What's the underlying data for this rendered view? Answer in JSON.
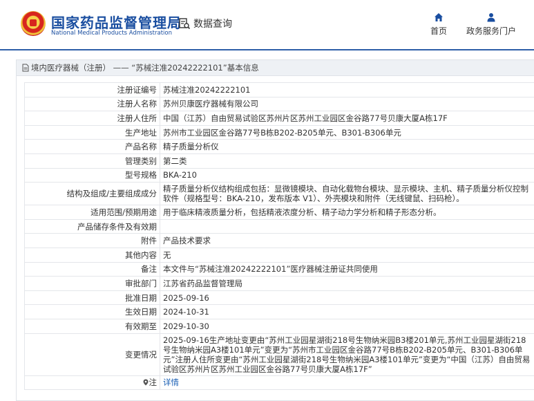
{
  "header": {
    "agency_cn": "国家药品监督管理局",
    "agency_en": "National Medical Products Administration",
    "query_label": "数据查询",
    "nav_home": "首页",
    "nav_portal": "政务服务门户"
  },
  "breadcrumb": "境内医疗器械（注册） —— “苏械注准20242222101”基本信息",
  "rows": [
    {
      "key": "注册证编号",
      "value": "苏械注准20242222101"
    },
    {
      "key": "注册人名称",
      "value": "苏州贝康医疗器械有限公司"
    },
    {
      "key": "注册人住所",
      "value": "中国（江苏）自由贸易试验区苏州片区苏州工业园区金谷路77号贝康大厦A栋17F"
    },
    {
      "key": "生产地址",
      "value": "苏州市工业园区金谷路77号B栋B202-B205单元、B301-B306单元"
    },
    {
      "key": "产品名称",
      "value": "精子质量分析仪"
    },
    {
      "key": "管理类别",
      "value": "第二类"
    },
    {
      "key": "型号规格",
      "value": "BKA-210"
    },
    {
      "key": "结构及组成/主要组成成分",
      "value": "精子质量分析仪结构组成包括：显微镜模块、自动化载物台模块、显示模块、主机、精子质量分析仪控制软件（规格型号：BKA-210，发布版本 V1）、外壳模块和附件（无线键鼠、扫码枪）。"
    },
    {
      "key": "适用范围/预期用途",
      "value": "用于临床精液质量分析，包括精液浓度分析、精子动力学分析和精子形态分析。"
    },
    {
      "key": "产品储存条件及有效期",
      "value": ""
    },
    {
      "key": "附件",
      "value": "产品技术要求"
    },
    {
      "key": "其他内容",
      "value": "无"
    },
    {
      "key": "备注",
      "value": "本文件与“苏械注准20242222101”医疗器械注册证共同使用"
    },
    {
      "key": "审批部门",
      "value": "江苏省药品监督管理局"
    },
    {
      "key": "批准日期",
      "value": "2025-09-16"
    },
    {
      "key": "生效日期",
      "value": "2024-10-31"
    },
    {
      "key": "有效期至",
      "value": "2029-10-30"
    },
    {
      "key": "变更情况",
      "value": "2025-09-16生产地址变更由“苏州工业园星湖街218号生物纳米园B3楼201单元,苏州工业园星湖街218号生物纳米园A3楼101单元”变更为“苏州市工业园区金谷路77号B栋B202-B205单元、B301-B306单元”注册人住所变更由“苏州工业园星湖街218号生物纳米园A3楼101单元”变更为“中国（江苏）自由贸易试验区苏州片区苏州工业园区金谷路77号贝康大厦A栋17F”"
    }
  ],
  "details": {
    "key": "注",
    "value": "详情"
  }
}
